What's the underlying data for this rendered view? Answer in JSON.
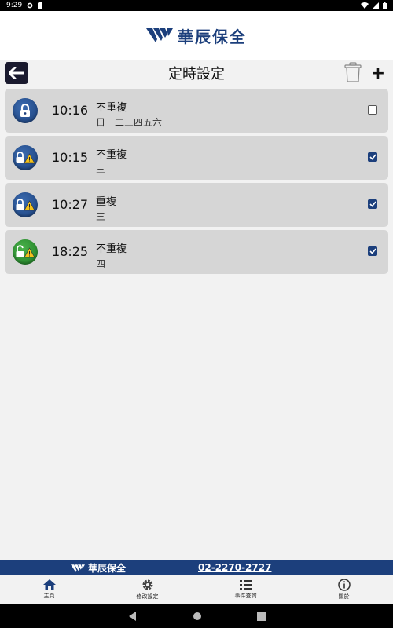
{
  "status_bar": {
    "time": "9:29"
  },
  "brand": {
    "name": "華辰保全"
  },
  "toolbar": {
    "title": "定時設定",
    "add_label": "+"
  },
  "schedules": [
    {
      "time": "10:16",
      "repeat": "不重複",
      "days": "日一二三四五六",
      "checked": false,
      "icon": "lock-closed-icon",
      "icon_color": "#1c3f7c"
    },
    {
      "time": "10:15",
      "repeat": "不重複",
      "days": "三",
      "checked": true,
      "icon": "lock-closed-warning-icon",
      "icon_color": "#1c3f7c"
    },
    {
      "time": "10:27",
      "repeat": "重複",
      "days": "三",
      "checked": true,
      "icon": "lock-closed-warning-icon",
      "icon_color": "#1c3f7c"
    },
    {
      "time": "18:25",
      "repeat": "不重複",
      "days": "四",
      "checked": true,
      "icon": "lock-open-warning-icon",
      "icon_color": "#2e9a34"
    }
  ],
  "footer": {
    "brand": "華辰保全",
    "phone": "02-2270-2727"
  },
  "bottom_nav": [
    {
      "label": "主頁",
      "icon": "home-icon"
    },
    {
      "label": "修改設定",
      "icon": "gear-icon"
    },
    {
      "label": "事件查詢",
      "icon": "list-icon"
    },
    {
      "label": "關於",
      "icon": "info-icon"
    }
  ],
  "colors": {
    "brand": "#1c3f7c",
    "item_bg": "#d6d6d6",
    "page_bg": "#f2f2f2"
  }
}
